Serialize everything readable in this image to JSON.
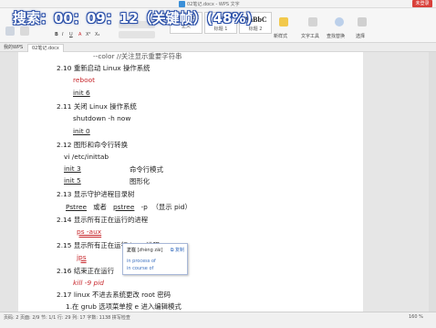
{
  "window": {
    "title": "02笔记.docx - WPS 文字",
    "login_label": "未登录"
  },
  "overlay": {
    "timer_text": "搜索：00：09：12（关键帧）(48%)"
  },
  "ribbon": {
    "styles": [
      {
        "sample": "AaBbCcDd",
        "label": "正文"
      },
      {
        "sample": "AaBt",
        "label": "标题 1"
      },
      {
        "sample": "AaBbC",
        "label": "标题 2"
      }
    ],
    "new_style_label": "新样式",
    "text_tools_label": "文字工具",
    "find_replace_label": "查找替换",
    "select_label": "选择"
  },
  "tabs": {
    "left_label": "我的WPS",
    "doc_label": "02笔记.docx"
  },
  "document": {
    "top_partial": "--color   //关注显示重要字符串",
    "s210_num": "2.10",
    "s210_title": "重新启动 Linux 操作系统",
    "s210_cmd1": "reboot",
    "s210_cmd2": "init 6",
    "s211_num": "2.11",
    "s211_title": "关闭 Linux 操作系统",
    "s211_cmd1": "shutdown -h now",
    "s211_cmd2": "init 0",
    "s212_num": "2.12",
    "s212_title": "图形和命令行转换",
    "s212_path": "vi /etc/inittab",
    "s212_init3": "init 3",
    "s212_init3_desc": "命令行模式",
    "s212_init5": "init 5",
    "s212_init5_desc": "图形化",
    "s213_num": "2.13",
    "s213_title": "显示守护进程目录树",
    "s213_cmd_a": "Pstree",
    "s213_or": "或者",
    "s213_cmd_b": "pstree",
    "s213_flag": "-p",
    "s213_note": "（显示 pid）",
    "s214_num": "2.14",
    "s214_title": "显示所有正在运行的进程",
    "s214_cmd": "ps -aux",
    "s215_num": "2.15",
    "s215_title": "显示所有正在运行 java 进程 /",
    "s215_cmd": "jps",
    "s216_num": "2.16",
    "s216_title": "结束正在运行",
    "s216_cmd": "kill -9 pid",
    "s217_num": "2.17",
    "s217_title": "linux  不进去系统更改 root 密码",
    "s217_step1": "1.在 grub 选项菜单按 e 进入编辑模式"
  },
  "tooltip": {
    "word": "正在",
    "phonetic": "[zhèng zài]",
    "copy_label": "复制",
    "option1": "in process of",
    "option2": "in course of"
  },
  "statusbar": {
    "left_text": "页码: 2   页面: 2/9   节: 1/1   行: 29   列: 17   字数: 1138   拼写检查",
    "right_text": "160 %"
  },
  "colors": {
    "red_text": "#c8292e",
    "timer_outline": "#2a4fa8",
    "login_button": "#d9403a"
  }
}
